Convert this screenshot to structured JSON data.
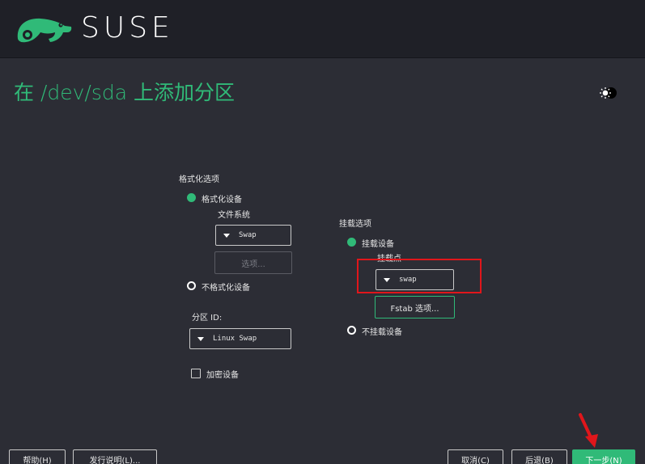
{
  "header": {
    "brand": "SUSE",
    "logo_icon": "chameleon-icon"
  },
  "page": {
    "title": "在 /dev/sda 上添加分区",
    "theme_toggle_icon": "sun-moon-icon"
  },
  "format_options": {
    "section_label": "格式化选项",
    "format_device": {
      "label": "格式化设备",
      "selected": true
    },
    "filesystem": {
      "label": "文件系统",
      "value": "Swap"
    },
    "options_button": "选项...",
    "no_format": {
      "label": "不格式化设备",
      "selected": false
    },
    "partition_id": {
      "label": "分区 ID:",
      "value": "Linux Swap"
    },
    "encrypt": {
      "label": "加密设备",
      "checked": false
    }
  },
  "mount_options": {
    "section_label": "挂载选项",
    "mount_device": {
      "label": "挂载设备",
      "selected": true
    },
    "mount_point": {
      "label": "挂载点",
      "value": "swap"
    },
    "fstab_button": "Fstab 选项...",
    "no_mount": {
      "label": "不挂载设备",
      "selected": false
    }
  },
  "footer": {
    "help": "帮助(H)",
    "release_notes": "发行说明(L)...",
    "cancel": "取消(C)",
    "back": "后退(B)",
    "next": "下一步(N)"
  },
  "colors": {
    "accent": "#30ba78",
    "background": "#2c2d35",
    "header": "#1f2027",
    "annotation": "#e0161b"
  }
}
